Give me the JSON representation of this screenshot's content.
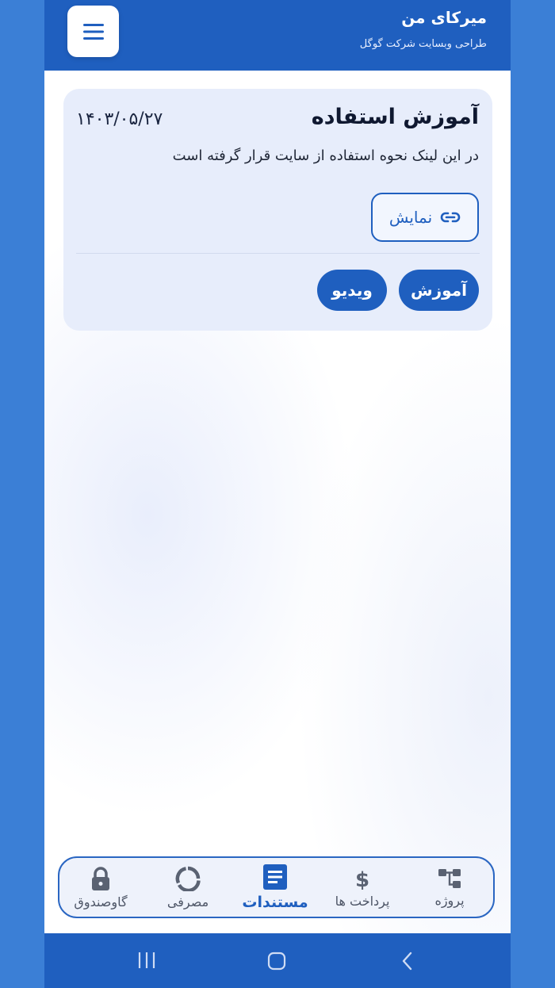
{
  "header": {
    "title": "میرکای من",
    "subtitle": "طراحی وبسایت شرکت گوگل",
    "menu_icon": "hamburger-icon"
  },
  "document_card": {
    "title": "آموزش استفاده",
    "date": "۱۴۰۳/۰۵/۲۷",
    "description": "در این لینک نحوه استفاده از سایت قرار گرفته است",
    "show_button_label": "نمایش",
    "show_button_icon": "link-icon",
    "tags": [
      "آموزش",
      "ویدیو"
    ]
  },
  "bottom_nav": {
    "items": [
      {
        "label": "پروژه",
        "icon": "hierarchy-icon"
      },
      {
        "label": "پرداخت ها",
        "icon": "dollar-icon"
      },
      {
        "label": "مستندات",
        "icon": "document-icon",
        "active": true
      },
      {
        "label": "مصرفی",
        "icon": "donut-chart-icon"
      },
      {
        "label": "گاوصندوق",
        "icon": "lock-icon"
      }
    ]
  },
  "colors": {
    "primary": "#1f5fbf",
    "card_bg": "#e7edfb",
    "outer_bg": "#3b7fd6"
  }
}
